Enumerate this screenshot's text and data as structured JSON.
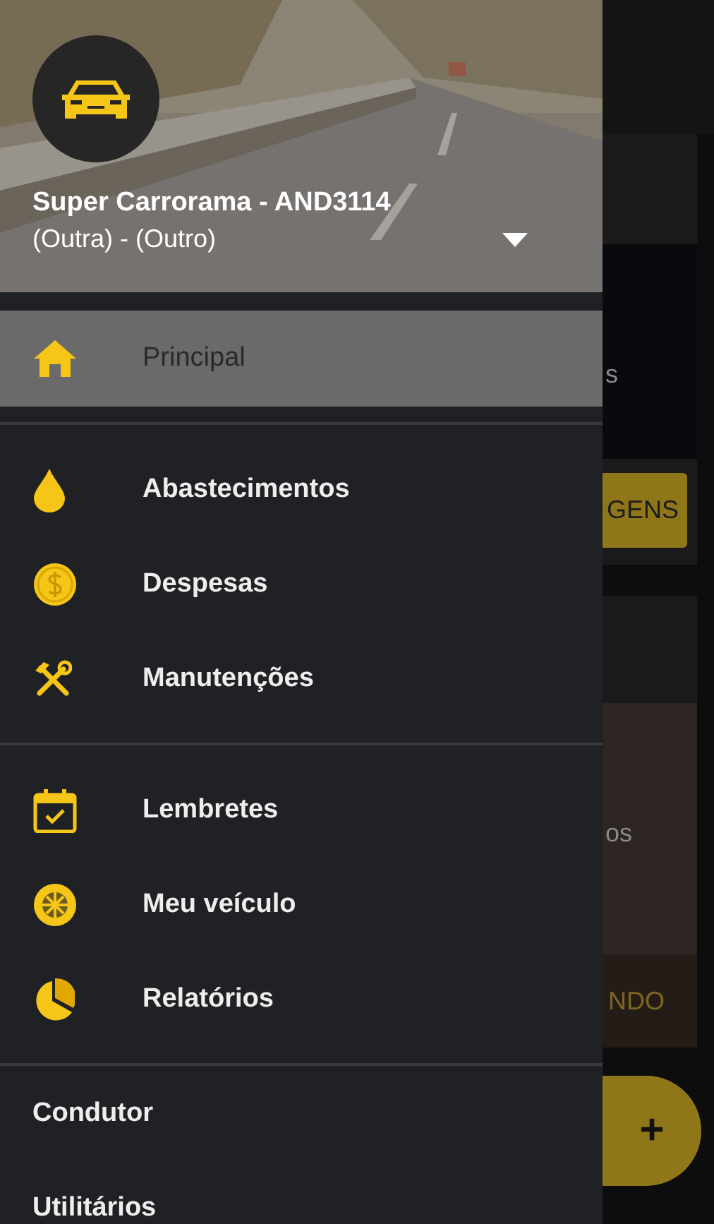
{
  "drawer": {
    "vehicle_title": "Super Carrorama - AND3114",
    "vehicle_subtitle": "(Outra) - (Outro)",
    "sections": [
      {
        "items": [
          {
            "label": "Principal",
            "selected": true
          }
        ]
      },
      {
        "items": [
          {
            "label": "Abastecimentos",
            "selected": false
          },
          {
            "label": "Despesas",
            "selected": false
          },
          {
            "label": "Manutenções",
            "selected": false
          }
        ]
      },
      {
        "items": [
          {
            "label": "Lembretes",
            "selected": false
          },
          {
            "label": "Meu veículo",
            "selected": false
          },
          {
            "label": "Relatórios",
            "selected": false
          }
        ]
      }
    ],
    "footer_items": [
      {
        "label": "Condutor"
      },
      {
        "label": "Utilitários"
      }
    ]
  },
  "background": {
    "card_1_text": "s",
    "card_1_button": "GENS",
    "card_2_text": "os",
    "card_2_button": "NDO",
    "fab": "+"
  }
}
